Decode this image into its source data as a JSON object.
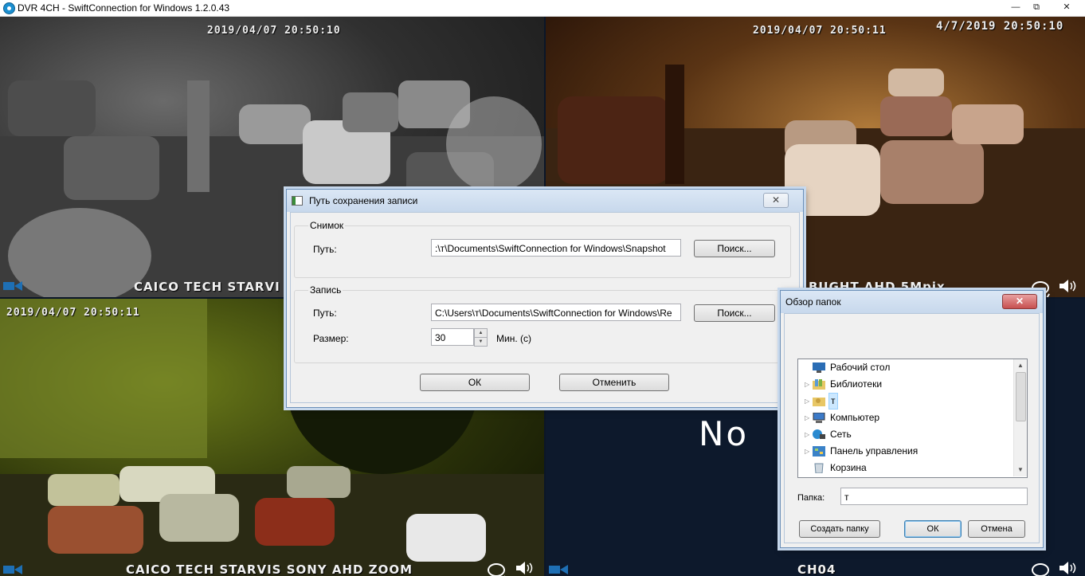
{
  "window": {
    "title": "DVR 4CH - SwiftConnection for Windows 1.2.0.43",
    "minimize": "—",
    "restore": "⧉",
    "close": "✕"
  },
  "cameras": {
    "cam1": {
      "timestamp": "2019/04/07 20:50:10",
      "caption": "CAICO TECH STARVI"
    },
    "cam2": {
      "timestamp": "2019/04/07 20:50:11",
      "timestamp_alt": "4/7/2019 20:50:10",
      "caption": "BUGHT AHD 5Mpix"
    },
    "cam3": {
      "timestamp": "2019/04/07 20:50:11",
      "caption": "CAICO TECH STARVIS SONY AHD ZOOM"
    },
    "cam4": {
      "nosignal": "No",
      "caption": "CH04"
    }
  },
  "save_dialog": {
    "title": "Путь сохранения записи",
    "close": "✕",
    "snapshot_group": "Снимок",
    "snapshot_path_label": "Путь:",
    "snapshot_path_value": ":\\т\\Documents\\SwiftConnection for Windows\\Snapshot",
    "snapshot_browse": "Поиск...",
    "record_group": "Запись",
    "record_path_label": "Путь:",
    "record_path_value": "C:\\Users\\т\\Documents\\SwiftConnection for Windows\\Re",
    "record_browse": "Поиск...",
    "size_label": "Размер:",
    "size_value": "30",
    "size_unit": "Мин. (с)",
    "ok": "ОК",
    "cancel": "Отменить"
  },
  "browse_dialog": {
    "title": "Обзор папок",
    "close": "✕",
    "tree": [
      {
        "label": "Рабочий стол",
        "icon": "desktop-icon",
        "expandable": false
      },
      {
        "label": "Библиотеки",
        "icon": "libraries-icon",
        "expandable": true
      },
      {
        "label": "т",
        "icon": "user-folder-icon",
        "expandable": true,
        "selected": true
      },
      {
        "label": "Компьютер",
        "icon": "computer-icon",
        "expandable": true
      },
      {
        "label": "Сеть",
        "icon": "network-icon",
        "expandable": true
      },
      {
        "label": "Панель управления",
        "icon": "control-panel-icon",
        "expandable": true
      },
      {
        "label": "Корзина",
        "icon": "recycle-bin-icon",
        "expandable": false
      }
    ],
    "folder_label": "Папка:",
    "folder_value": "т",
    "new_folder": "Создать папку",
    "ok": "ОК",
    "cancel": "Отмена"
  },
  "colors": {
    "dialog_border": "#6b8fb8",
    "close_red": "#c75050",
    "selection": "#cce8ff"
  }
}
